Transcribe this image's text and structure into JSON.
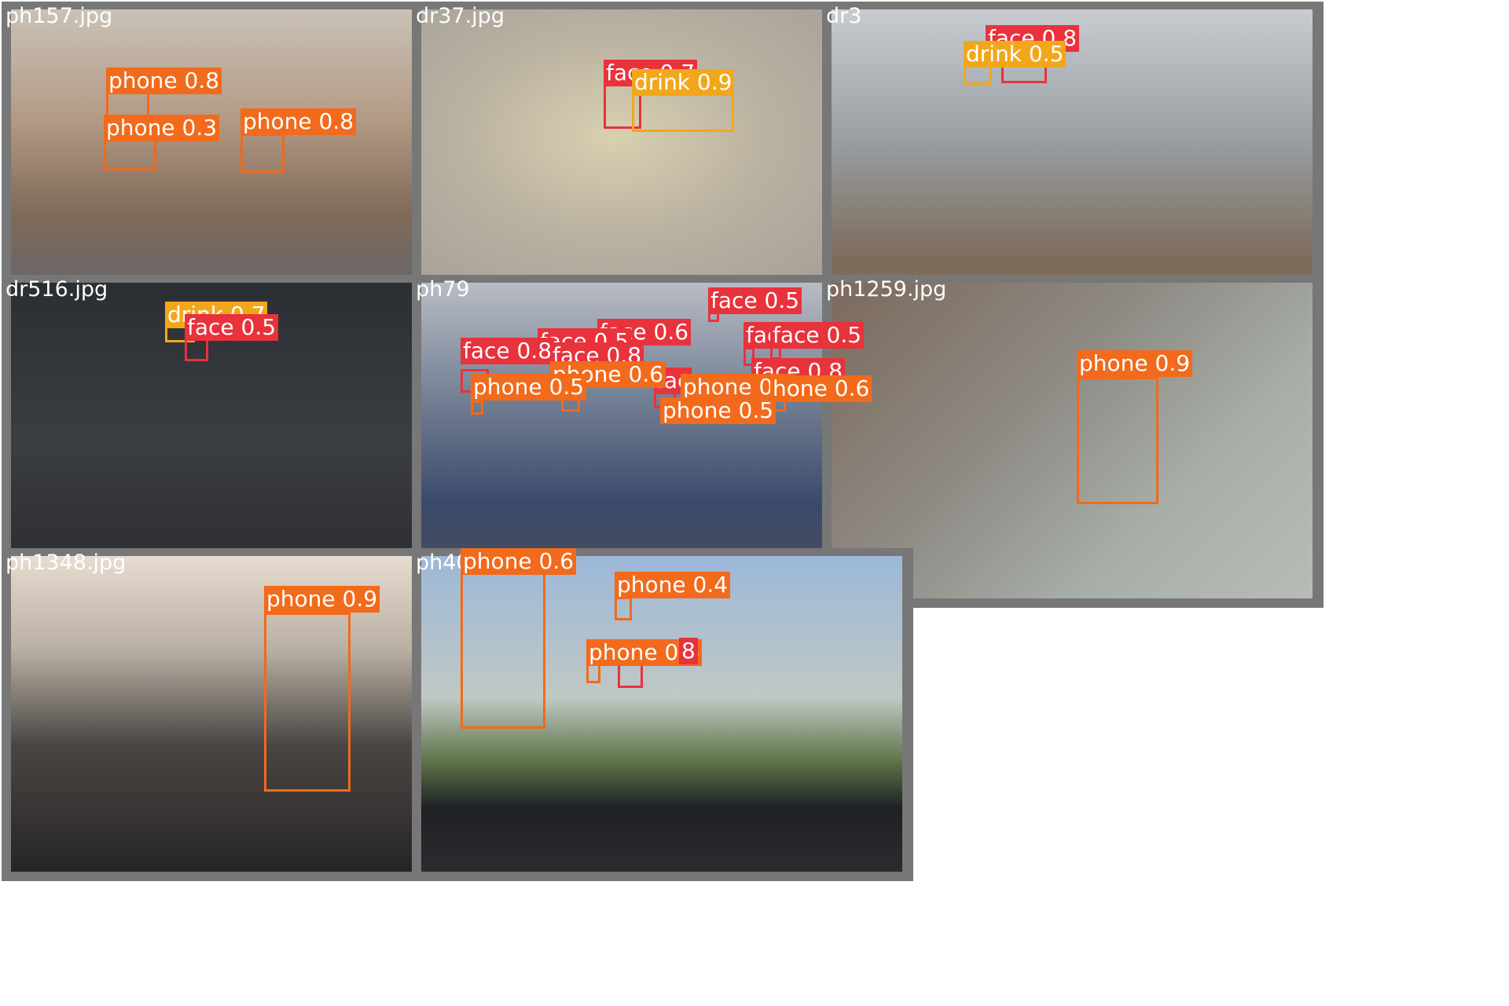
{
  "colors": {
    "face": "#e8323c",
    "drink": "#f2a71b",
    "phone": "#f26a1b",
    "tile_border": "#777777",
    "background": "#ffffff"
  },
  "tiles": [
    {
      "filename": "ph157.jpg",
      "bg": "linear-gradient(180deg,#c9c2b6 0%,#b39a85 35%,#7f6a58 65%,#5b6473 100%)",
      "detections": [
        {
          "label": "phone 0.8",
          "cls": "phone"
        },
        {
          "label": "phone 0.3",
          "cls": "phone"
        },
        {
          "label": "phone 0.8",
          "cls": "phone"
        }
      ]
    },
    {
      "filename": "dr37.jpg",
      "bg": "radial-gradient(ellipse at 40% 40%,#d8d0b0 0%,#b8b0a0 40%,#9a9694 100%)",
      "detections": [
        {
          "label": "face 0.7",
          "cls": "face"
        },
        {
          "label": "drink 0.9",
          "cls": "drink"
        }
      ]
    },
    {
      "filename": "dr3",
      "bg": "linear-gradient(180deg,#c8ccd0 0%,#9aa0a4 40%,#7c6b5a 80%,#8a7662 100%)",
      "detections": [
        {
          "label": "face 0.8",
          "cls": "face"
        },
        {
          "label": "drink 0.5",
          "cls": "drink"
        }
      ]
    },
    {
      "filename": "dr516.jpg",
      "bg": "linear-gradient(180deg,#2b2e33 0%,#3a3d42 50%,#2a2a2c 100%)",
      "detections": [
        {
          "label": "drink 0.7",
          "cls": "drink"
        },
        {
          "label": "face 0.5",
          "cls": "face"
        }
      ]
    },
    {
      "filename": "ph79",
      "bg": "linear-gradient(180deg,#b8bcc4 0%,#6d7a90 40%,#3b4a6a 70%,#4a4f5c 100%)",
      "detections": [
        {
          "label": "face 0.5",
          "cls": "face"
        },
        {
          "label": "face 0.6",
          "cls": "face"
        },
        {
          "label": "face 0.5",
          "cls": "face"
        },
        {
          "label": "face 0.8",
          "cls": "face"
        },
        {
          "label": "face 0.8",
          "cls": "face"
        },
        {
          "label": "fac",
          "cls": "face"
        },
        {
          "label": "face 0.5",
          "cls": "face"
        },
        {
          "label": "face 0.8",
          "cls": "face"
        },
        {
          "label": "fac",
          "cls": "face"
        },
        {
          "label": "phone 0.6",
          "cls": "phone"
        },
        {
          "label": "phone 0.5",
          "cls": "phone"
        },
        {
          "label": "phone 0.4",
          "cls": "phone"
        },
        {
          "label": "hone 0.6",
          "cls": "phone"
        },
        {
          "label": "phone 0.5",
          "cls": "phone"
        }
      ]
    },
    {
      "filename": "ph1259.jpg",
      "bg": "linear-gradient(135deg,#7c6a5c 0%,#8e8a84 40%,#a7aea8 70%,#b8bcb6 100%)",
      "detections": [
        {
          "label": "phone 0.9",
          "cls": "phone"
        }
      ]
    },
    {
      "filename": "ph1348.jpg",
      "bg": "linear-gradient(180deg,#e6dcd0 0%,#b8aea2 30%,#4a4644 60%,#262424 100%)",
      "detections": [
        {
          "label": "phone 0.9",
          "cls": "phone"
        }
      ]
    },
    {
      "filename": "ph40",
      "bg": "linear-gradient(180deg,#9cb8d8 0%,#c0c8c4 45%,#5e7448 65%,#1e2024 80%,#2a2c30 100%)",
      "detections": [
        {
          "label": "phone 0.6",
          "cls": "phone"
        },
        {
          "label": "phone 0.4",
          "cls": "phone"
        },
        {
          "label": "phone 0.6",
          "cls": "phone"
        },
        {
          "label": "8",
          "cls": "face"
        }
      ]
    }
  ]
}
